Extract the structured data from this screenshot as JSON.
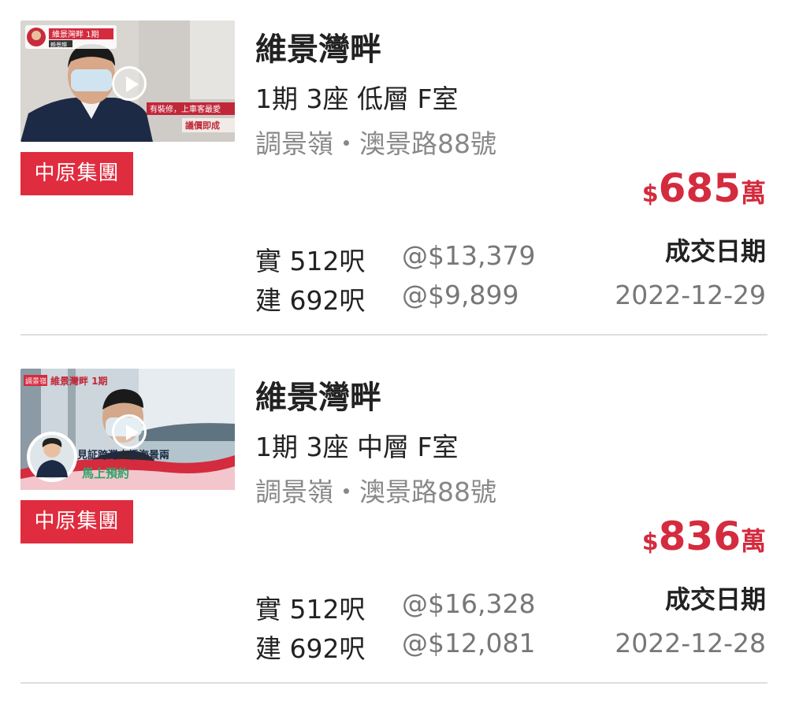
{
  "listings": [
    {
      "estate": "維景灣畔",
      "unit": "1期 3座 低層 F室",
      "address": "調景嶺・澳景路88號",
      "price": {
        "currency": "$",
        "amount": "685",
        "unit": "萬"
      },
      "saleable": {
        "label": "實 512呎",
        "psf": "@$13,379"
      },
      "gross": {
        "label": "建 692呎",
        "psf": "@$9,899"
      },
      "deal_label": "成交日期",
      "deal_date": "2022-12-29",
      "agency": "中原集團",
      "thumbnail": {
        "banner": "維景灣畔 1期",
        "agent_name": "賴景輝",
        "caption1": "有裝修，上車客最愛",
        "caption2": "議價即成"
      }
    },
    {
      "estate": "維景灣畔",
      "unit": "1期 3座 中層 F室",
      "address": "調景嶺・澳景路88號",
      "price": {
        "currency": "$",
        "amount": "836",
        "unit": "萬"
      },
      "saleable": {
        "label": "實 512呎",
        "psf": "@$16,328"
      },
      "gross": {
        "label": "建 692呎",
        "psf": "@$12,081"
      },
      "deal_label": "成交日期",
      "deal_date": "2022-12-28",
      "agency": "中原集團",
      "thumbnail": {
        "tag": "調景嶺",
        "banner": "維景灣畔 1期",
        "caption1": "見証跨灣大橋海景兩",
        "caption2": "馬上預約"
      }
    }
  ],
  "colors": {
    "accent": "#d42b3e",
    "badge": "#e02c3f",
    "muted": "#888888"
  },
  "icons": [
    "play-icon"
  ]
}
